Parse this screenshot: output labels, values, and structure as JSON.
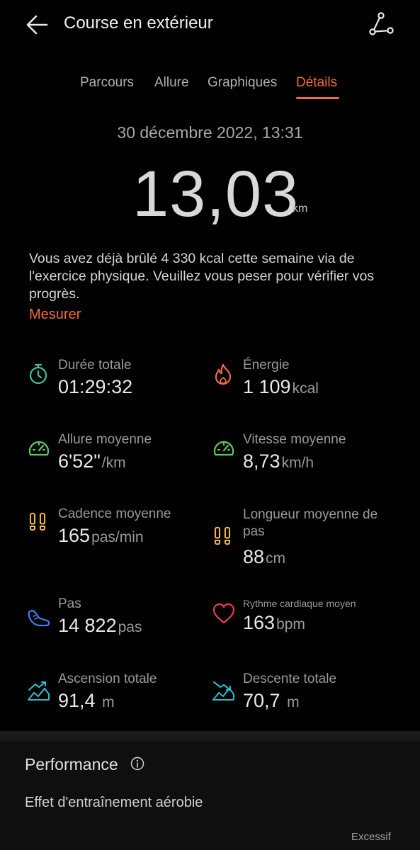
{
  "header": {
    "title": "Course en extérieur",
    "back_icon": "arrow-left-icon",
    "share_icon": "route-share-icon"
  },
  "tabs": [
    {
      "label": "Parcours",
      "active": false
    },
    {
      "label": "Allure",
      "active": false
    },
    {
      "label": "Graphiques",
      "active": false
    },
    {
      "label": "Détails",
      "active": true
    }
  ],
  "summary": {
    "date": "30 décembre 2022, 13:31",
    "distance": "13,03",
    "distance_unit": "km"
  },
  "message": {
    "text": "Vous avez déjà brûlé 4 330 kcal cette semaine via de l'exercice physique. Veuillez vous peser pour vérifier vos progrès.",
    "action": "Mesurer"
  },
  "stats": {
    "duration": {
      "label": "Durée totale",
      "value": "01:29:32",
      "unit": ""
    },
    "energy": {
      "label": "Énergie",
      "value": "1 109",
      "unit": "kcal"
    },
    "avg_pace": {
      "label": "Allure moyenne",
      "value": "6'52\"",
      "unit": "/km"
    },
    "avg_speed": {
      "label": "Vitesse moyenne",
      "value": "8,73",
      "unit": "km/h"
    },
    "avg_cadence": {
      "label": "Cadence moyenne",
      "value": "165",
      "unit": "pas/min"
    },
    "avg_stride_line1": "Longueur moyenne de",
    "avg_stride_line2": "pas",
    "avg_stride": {
      "value": "88",
      "unit": "cm"
    },
    "steps": {
      "label": "Pas",
      "value": "14 822",
      "unit": "pas"
    },
    "heart_rate": {
      "label": "Rythme cardiaque moyen",
      "value": "163",
      "unit": "bpm"
    },
    "ascent": {
      "label": "Ascension totale",
      "value": "91,4",
      "unit": "m"
    },
    "descent": {
      "label": "Descente totale",
      "value": "70,7",
      "unit": "m"
    }
  },
  "colors": {
    "accent": "#f26a3d",
    "timer": "#3cc2a0",
    "energy": "#f26a3d",
    "gauge": "#5cc95c",
    "footprints": "#f2b544",
    "shoe": "#3f7ff0",
    "heart": "#ee3b4e",
    "elevation": "#2fb8c8"
  },
  "performance": {
    "title": "Performance",
    "subtitle": "Effet d'entraînement aérobie",
    "level": "Excessif"
  }
}
